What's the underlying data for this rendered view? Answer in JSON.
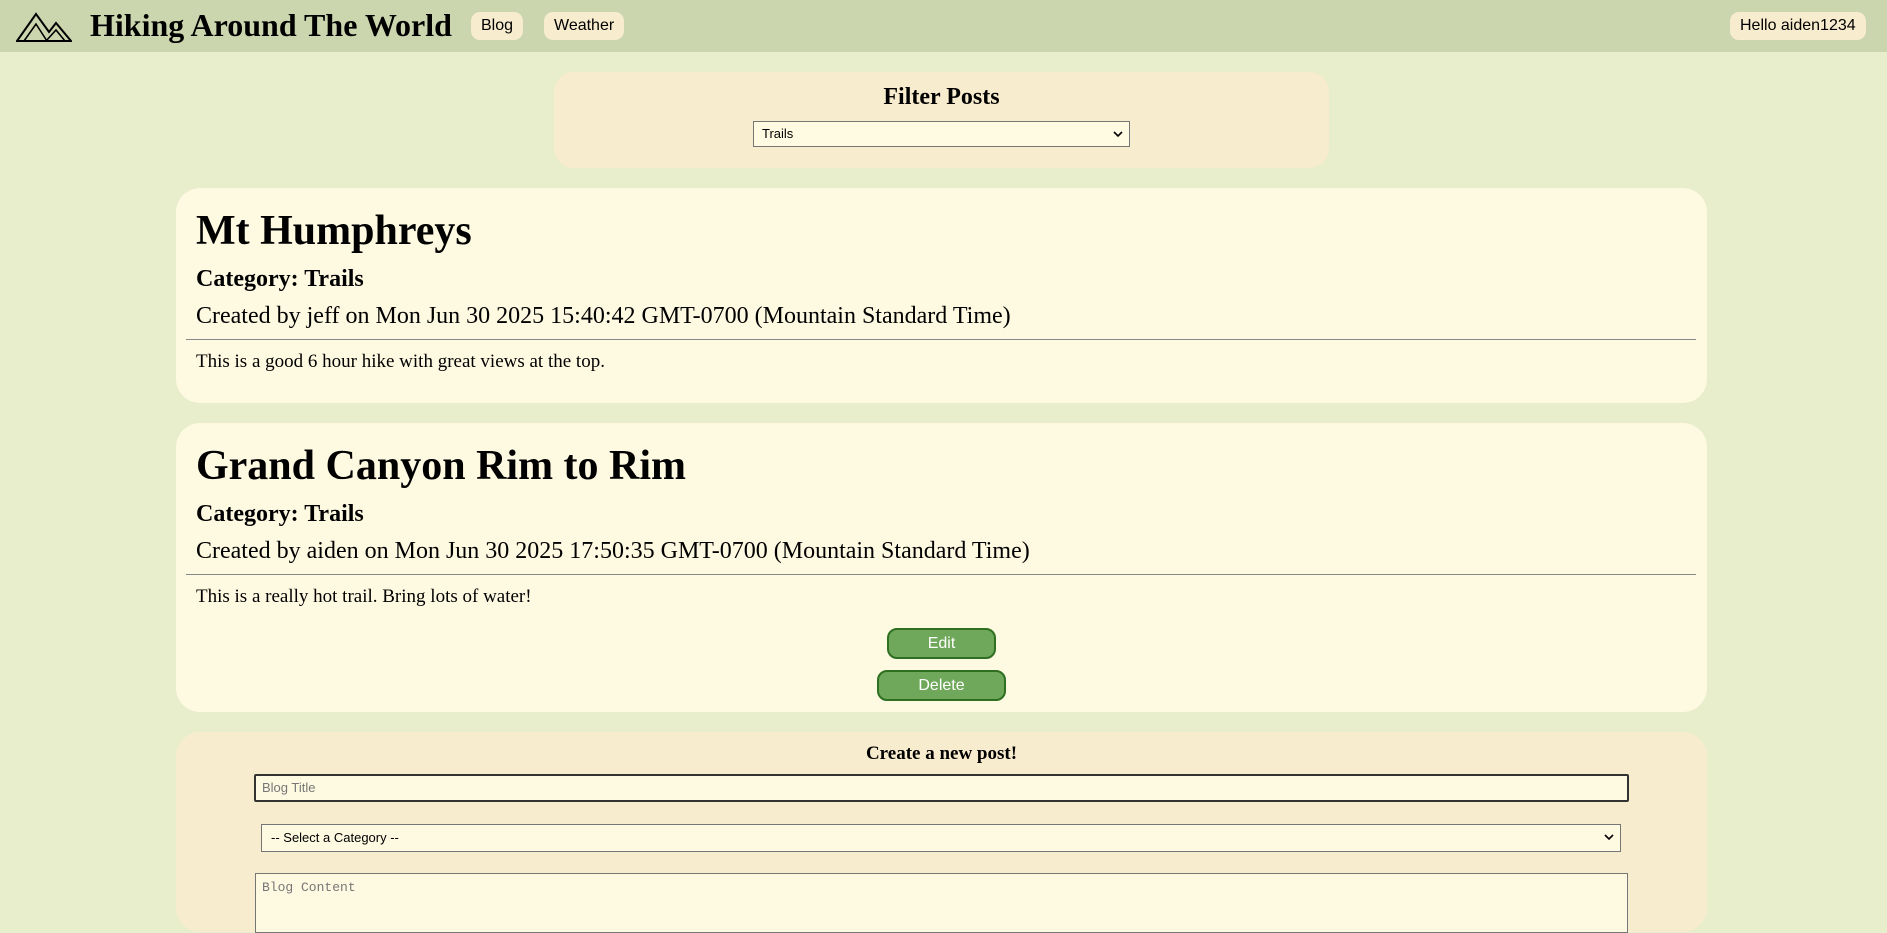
{
  "header": {
    "logo_icon": "mountains-icon",
    "site_title": "Hiking Around The World",
    "nav": [
      {
        "label": "Blog"
      },
      {
        "label": "Weather"
      }
    ],
    "user_greeting": "Hello aiden1234"
  },
  "filter": {
    "title": "Filter Posts",
    "selected": "Trails"
  },
  "posts": [
    {
      "title": "Mt Humphreys",
      "category": "Category: Trails",
      "meta": "Created by jeff on Mon Jun 30 2025 15:40:42 GMT-0700 (Mountain Standard Time)",
      "content": "This is a good 6 hour hike with great views at the top."
    },
    {
      "title": "Grand Canyon Rim to Rim",
      "category": "Category: Trails",
      "meta": "Created by aiden on Mon Jun 30 2025 17:50:35 GMT-0700 (Mountain Standard Time)",
      "content": "This is a really hot trail. Bring lots of water!",
      "edit_label": "Edit",
      "delete_label": "Delete"
    }
  ],
  "create": {
    "title": "Create a new post!",
    "title_placeholder": "Blog Title",
    "category_selected": "-- Select a Category --",
    "content_placeholder": "Blog Content"
  },
  "colors": {
    "page_bg": "#e8edcc",
    "header_bg": "#ccd6ae",
    "panel_bg": "#f8ecce",
    "post_bg": "#fef9e1",
    "button_green": "#6fa85a",
    "button_border": "#2f6f22"
  }
}
